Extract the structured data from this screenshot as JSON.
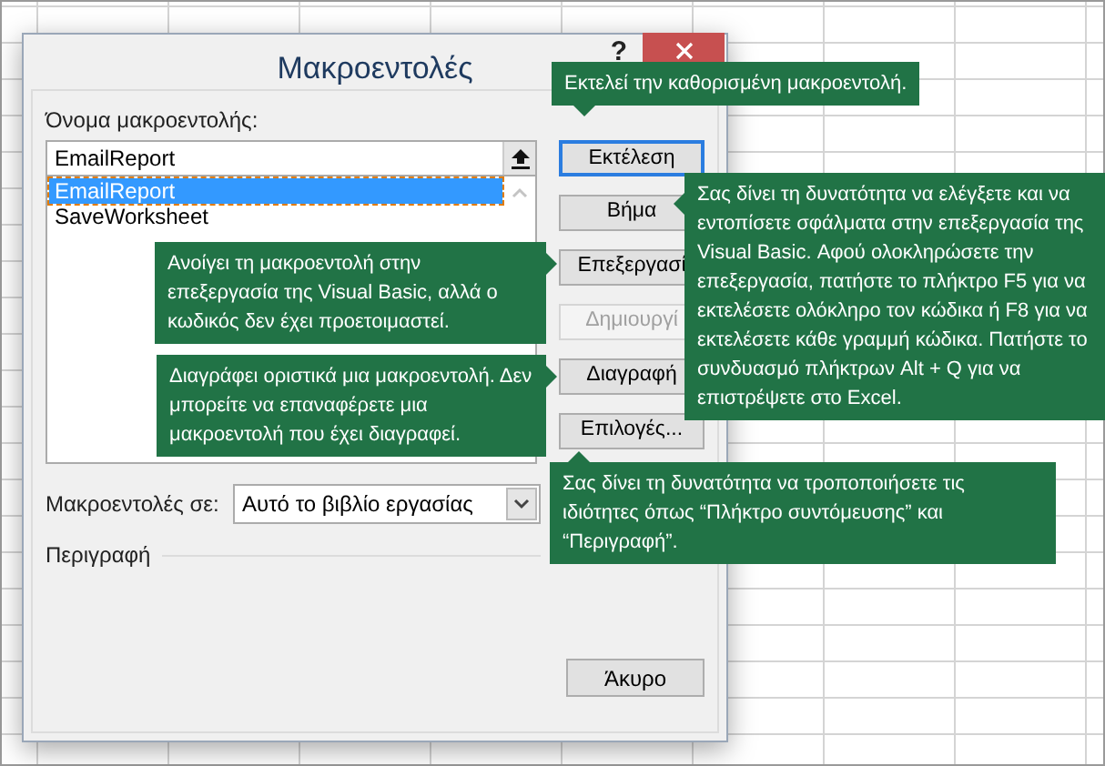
{
  "dialog": {
    "title": "Μακροεντολές",
    "help": "?",
    "macro_name": {
      "label": "Όνομα μακροεντολής:",
      "value": "EmailReport"
    },
    "macros": [
      {
        "name": "EmailReport",
        "selected": true
      },
      {
        "name": "SaveWorksheet",
        "selected": false
      }
    ],
    "buttons": [
      {
        "label": "Εκτέλεση",
        "focused": true,
        "disabled": false
      },
      {
        "label": "Βήμα",
        "focused": false,
        "disabled": false
      },
      {
        "label": "Επεξεργασί",
        "focused": false,
        "disabled": false
      },
      {
        "label": "Δημιουργί",
        "focused": false,
        "disabled": true
      },
      {
        "label": "Διαγραφή",
        "focused": false,
        "disabled": false
      },
      {
        "label": "Επιλογές...",
        "focused": false,
        "disabled": false
      }
    ],
    "macros_in": {
      "label": "Μακροεντολές σε:",
      "value": "Αυτό το βιβλίο εργασίας"
    },
    "description_label": "Περιγραφή",
    "cancel": "Άκυρο"
  },
  "callouts": [
    {
      "text": "Εκτελεί την καθορισμένη μακροεντολή."
    },
    {
      "text": "Ανοίγει τη μακροεντολή στην επεξεργασία της Visual Basic, αλλά ο κωδικός δεν έχει προετοιμαστεί."
    },
    {
      "text": "Διαγράφει οριστικά μια μακροεντολή. Δεν μπορείτε να επαναφέρετε μια μακροεντολή που έχει διαγραφεί."
    },
    {
      "text": "Σας δίνει τη δυνατότητα να ελέγξετε και να εντοπίσετε σφάλματα στην επεξεργασία της Visual Basic. Αφού ολοκληρώσετε την επεξεργασία, πατήστε το πλήκτρο F5 για να εκτελέσετε ολόκληρο τον κώδικα ή F8 για να εκτελέσετε κάθε γραμμή κώδικα. Πατήστε το συνδυασμό πλήκτρων Alt + Q για να επιστρέψετε στο Excel."
    },
    {
      "text": "Σας δίνει τη δυνατότητα να τροποποιήσετε τις ιδιότητες όπως “Πλήκτρο συντόμευσης” και “Περιγραφή”."
    }
  ]
}
